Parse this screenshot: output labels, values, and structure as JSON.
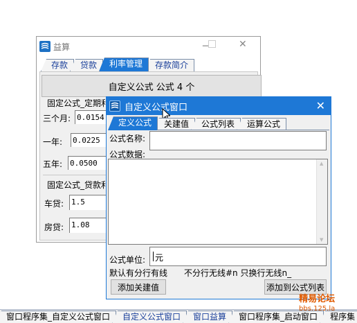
{
  "bg_window": {
    "title": "益算",
    "close_glyph": "✕",
    "tabs": [
      {
        "label": "存款",
        "active": false
      },
      {
        "label": "贷款",
        "active": false
      },
      {
        "label": "利率管理",
        "active": true
      },
      {
        "label": "存款简介",
        "active": false
      }
    ],
    "big_button": "自定义公式  公式 4 个",
    "fixed_deposit_group": "固定公式_定期利",
    "three_month_label": "三个月:",
    "three_month_value": "0.0154",
    "one_year_label": "一年:",
    "one_year_value": "0.0225",
    "five_year_label": "五年:",
    "five_year_value": "0.0500",
    "fixed_loan_group": "固定公式_贷款利",
    "car_loan_label": "车贷:",
    "car_loan_value": "1.5",
    "house_loan_label": "房贷:",
    "house_loan_value": "1.08"
  },
  "dialog": {
    "title": "自定义公式窗口",
    "close_glyph": "✕",
    "tabs": [
      {
        "label": "定义公式",
        "active": true
      },
      {
        "label": "关建值",
        "active": false
      },
      {
        "label": "公式列表",
        "active": false
      },
      {
        "label": "运算公式",
        "active": false
      }
    ],
    "name_label": "公式名称:",
    "name_value": "",
    "data_label": "公式数据:",
    "data_value": "",
    "unit_label": "公式单位:",
    "unit_value": "元",
    "hint_left": "默认有分行有线",
    "hint_right": "不分行无线#n 只换行无线n_",
    "add_key_button": "添加关建值",
    "add_to_list_button": "添加到公式列表"
  },
  "taskbar": {
    "tabs": [
      {
        "label": "窗口程序集_自定义公式窗口",
        "active": false,
        "blue": false
      },
      {
        "label": "自定义公式窗口",
        "active": false,
        "blue": true
      },
      {
        "label": "窗口益算",
        "active": false,
        "blue": true
      },
      {
        "label": "窗口程序集_启动窗口",
        "active": false,
        "blue": false
      },
      {
        "label": "程序集",
        "active": false,
        "blue": false
      }
    ]
  },
  "watermark": {
    "line1": "精易论坛",
    "line2": "bbs.125.la"
  },
  "colors": {
    "accent": "#1e78d6",
    "panel": "#f0f0f0"
  }
}
